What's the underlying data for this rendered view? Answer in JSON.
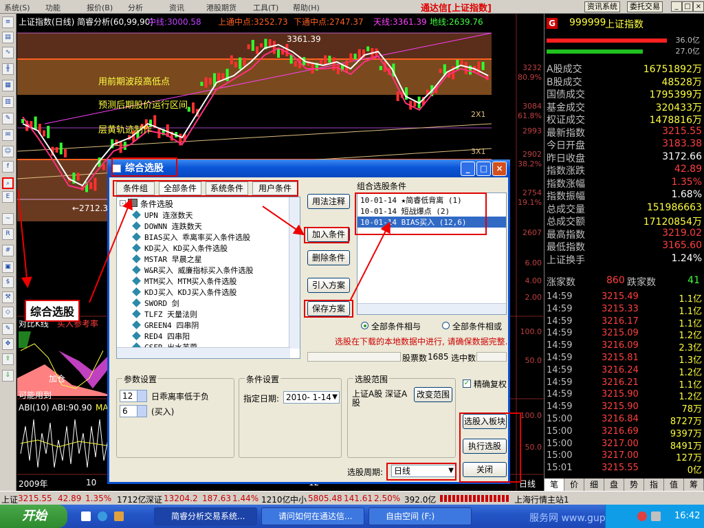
{
  "menubar": {
    "items": [
      "系统(S)",
      "功能",
      "报价(B)",
      "分析",
      "资讯",
      "港股期货",
      "工具(T)",
      "帮助(H)"
    ],
    "brand": "通达信[上证指数]",
    "btn_info": "资讯系统",
    "btn_trade": "委托交易"
  },
  "chart": {
    "header_title": "上证指数(日线) 简睿分析(60,99,90)",
    "mid_line": "中线:3000.58",
    "upper_band": "上通中点:3252.73",
    "lower_band": "下通中点:2747.37",
    "sky_line": "天线:3361.39",
    "ground_line": "地线:2639.76",
    "high_label": "3361.39",
    "low_label": "←2712.3",
    "ann1": "用前期波段高低点",
    "ann2": "预测后期股价运行区间",
    "ann3": "层黄轨迹制作",
    "y_ticks": [
      "3232",
      "80.9%",
      "3084",
      "61.8%",
      "2993",
      "2902",
      "38.2%",
      "2754",
      "19.1%",
      "2607",
      "6.00",
      "4.00",
      "2.00",
      "100.0",
      "50.0",
      "100.0",
      "50.0"
    ],
    "mark_2x1": "2X1",
    "mark_3x1": "3X1",
    "sub1_label": "对比K线",
    "sub1_label2": "买入参考率",
    "sub2_label": "可能用到",
    "sub3_label": "ABI(10) ABI:90.90",
    "sub3_ma": "MA",
    "time_year": "2009年",
    "time_10": "10",
    "time_12": "12",
    "axis_unit": "日线",
    "signal_text": "加仓"
  },
  "right": {
    "code": "999999",
    "name": "上证指数",
    "bar1": "36.0亿",
    "bar2": "27.0亿",
    "stats": [
      {
        "k": "A股成交",
        "v": "16751892万",
        "c": "#ffff40"
      },
      {
        "k": "B股成交",
        "v": "48528万",
        "c": "#ffff40"
      },
      {
        "k": "国债成交",
        "v": "1795399万",
        "c": "#ffff40"
      },
      {
        "k": "基金成交",
        "v": "320433万",
        "c": "#ffff40"
      },
      {
        "k": "权证成交",
        "v": "1478816万",
        "c": "#ffff40"
      },
      {
        "k": "最新指数",
        "v": "3215.55",
        "c": "#ff4040"
      },
      {
        "k": "今日开盘",
        "v": "3183.38",
        "c": "#ff4040"
      },
      {
        "k": "昨日收盘",
        "v": "3172.66",
        "c": "#ffffff"
      },
      {
        "k": "指数涨跌",
        "v": "42.89",
        "c": "#ff4040"
      },
      {
        "k": "指数涨幅",
        "v": "1.35%",
        "c": "#ff4040"
      },
      {
        "k": "指数振幅",
        "v": "1.68%",
        "c": "#ffffff"
      },
      {
        "k": "总成交量",
        "v": "151986663",
        "c": "#ffff40"
      },
      {
        "k": "总成交额",
        "v": "17120854万",
        "c": "#ffff40"
      },
      {
        "k": "最高指数",
        "v": "3219.02",
        "c": "#ff4040"
      },
      {
        "k": "最低指数",
        "v": "3165.60",
        "c": "#ff4040"
      },
      {
        "k": "上证换手",
        "v": "1.24%",
        "c": "#ffffff"
      }
    ],
    "up_label": "涨家数",
    "up_count": "860",
    "down_label": "跌家数",
    "down_count": "41",
    "ticks": [
      {
        "t": "14:59",
        "p": "3215.49",
        "q": "1.1亿"
      },
      {
        "t": "14:59",
        "p": "3215.33",
        "q": "1.1亿"
      },
      {
        "t": "14:59",
        "p": "3216.17",
        "q": "1.1亿"
      },
      {
        "t": "14:59",
        "p": "3215.09",
        "q": "1.2亿"
      },
      {
        "t": "14:59",
        "p": "3216.09",
        "q": "2.3亿"
      },
      {
        "t": "14:59",
        "p": "3215.81",
        "q": "1.3亿"
      },
      {
        "t": "14:59",
        "p": "3216.24",
        "q": "1.2亿"
      },
      {
        "t": "14:59",
        "p": "3216.21",
        "q": "1.1亿"
      },
      {
        "t": "14:59",
        "p": "3215.90",
        "q": "1.2亿"
      },
      {
        "t": "14:59",
        "p": "3215.90",
        "q": "78万"
      },
      {
        "t": "15:00",
        "p": "3216.84",
        "q": "8727万"
      },
      {
        "t": "15:00",
        "p": "3216.69",
        "q": "9397万"
      },
      {
        "t": "15:00",
        "p": "3217.00",
        "q": "8491万"
      },
      {
        "t": "15:00",
        "p": "3217.00",
        "q": "127万"
      },
      {
        "t": "15:01",
        "p": "3215.55",
        "q": "0亿"
      }
    ],
    "bottom_tabs": [
      "笔",
      "价",
      "细",
      "盘",
      "势",
      "指",
      "值",
      "筹"
    ]
  },
  "dialog": {
    "title": "综合选股",
    "tabs": [
      "条件组",
      "全部条件",
      "系统条件",
      "用户条件"
    ],
    "tree_root": "条件选股",
    "tree_items": [
      "UPN 连涨数天",
      "DOWNN 连跌数天",
      "BIAS买入 乖离率买入条件选股",
      "KD买入 KD买入条件选股",
      "MSTAR 早晨之星",
      "W&R买入 威廉指标买入条件选股",
      "MTM买入 MTM买入条件选股",
      "KDJ买入 KDJ买入条件选股",
      "SWORD 剑",
      "TLFZ 天量法则",
      "GREEN4 四串阴",
      "RED4 四串阳",
      "CSFR 出水芙蓉"
    ],
    "btn_usage": "用法注释",
    "btn_add": "加入条件",
    "btn_delete": "删除条件",
    "btn_import": "引入方案",
    "btn_save": "保存方案",
    "combo_title": "组合选股条件",
    "conditions": [
      "10-01-14 ★简睿低背离 (1)",
      "10-01-14 短战爆点 (2)",
      "10-01-14 BIAS买入 (12,6)"
    ],
    "radio_and": "全部条件相与",
    "radio_or": "全部条件相或",
    "warn": "选股在下载的本地数据中进行, 请确保数据完整.",
    "stock_count_label": "股票数",
    "stock_count": "1685",
    "selected_label": "选中数",
    "param_title": "参数设置",
    "param1_val": "12",
    "param1_label": "日乖离率低于负",
    "param2_val": "6",
    "param2_label": "(买入)",
    "cond_title": "条件设置",
    "date_label": "指定日期:",
    "date_val": "2010- 1-14",
    "range_title": "选股范围",
    "range_text": "上证A股 深证A股",
    "btn_range": "改变范围",
    "precise": "精确复权",
    "period_label": "选股周期:",
    "period_val": "日线",
    "btn_to_block": "选股入板块",
    "btn_run": "执行选股",
    "btn_close": "关闭"
  },
  "callout": "综合选股",
  "status": {
    "sh": "上证",
    "sh_v": "3215.55",
    "sh_c": "42.89",
    "sh_p": "1.35%",
    "sh_amt": "1712亿",
    "sz": "深证",
    "sz_v": "13204.2",
    "sz_c": "187.63",
    "sz_p": "1.44%",
    "sz_amt": "1210亿",
    "zx": "中小",
    "zx_v": "5805.48",
    "zx_c": "141.61",
    "zx_p": "2.50%",
    "zx_amt": "392.0亿",
    "site": "上海行情主站1"
  },
  "taskbar": {
    "start": "开始",
    "tasks": [
      "简睿分析交易系统...",
      "请问如何在通达信...",
      "自由空间 (F:)"
    ],
    "clock": "16:42",
    "watermark": "服务网 www.gupang.com"
  },
  "colors": {
    "red": "#e00000",
    "up": "#ff4040",
    "yellow": "#ffff40",
    "dialog_blue": "#0a56d8"
  }
}
